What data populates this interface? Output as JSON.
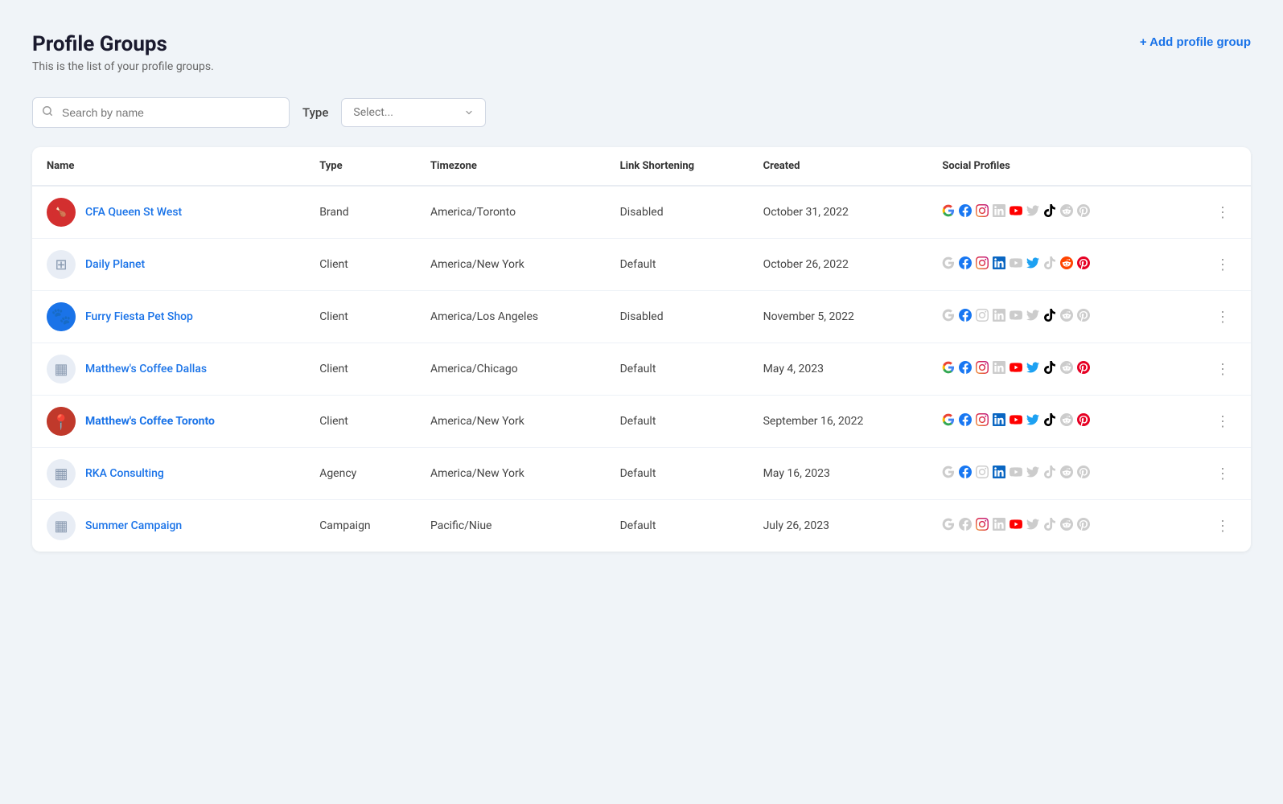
{
  "page": {
    "title": "Profile Groups",
    "subtitle": "This is the list of your profile groups.",
    "add_button_label": "+ Add profile group"
  },
  "filters": {
    "search_placeholder": "Search by name",
    "type_label": "Type",
    "type_select_placeholder": "Select..."
  },
  "table": {
    "columns": [
      "Name",
      "Type",
      "Timezone",
      "Link Shortening",
      "Created",
      "Social Profiles"
    ],
    "rows": [
      {
        "id": 1,
        "name": "CFA Queen St West",
        "avatar_type": "image",
        "avatar_emoji": "🍗",
        "avatar_bg": "#e8241a",
        "type": "Brand",
        "timezone": "America/Toronto",
        "link_shortening": "Disabled",
        "created": "October 31, 2022",
        "socials": {
          "google": true,
          "facebook": true,
          "instagram": true,
          "linkedin": false,
          "youtube": true,
          "twitter": false,
          "tiktok": true,
          "reddit": false,
          "pinterest": false
        }
      },
      {
        "id": 2,
        "name": "Daily Planet",
        "avatar_type": "building",
        "avatar_emoji": "🏢",
        "type": "Client",
        "timezone": "America/New York",
        "link_shortening": "Default",
        "created": "October 26, 2022",
        "socials": {
          "google": false,
          "facebook": true,
          "instagram": true,
          "linkedin": true,
          "youtube": false,
          "twitter": true,
          "tiktok": false,
          "reddit": true,
          "pinterest": true
        }
      },
      {
        "id": 3,
        "name": "Furry Fiesta Pet Shop",
        "avatar_type": "image",
        "avatar_emoji": "🐾",
        "avatar_bg": "#1a73e8",
        "type": "Client",
        "timezone": "America/Los Angeles",
        "link_shortening": "Disabled",
        "created": "November 5, 2022",
        "socials": {
          "google": false,
          "facebook": true,
          "instagram": false,
          "linkedin": false,
          "youtube": false,
          "twitter": false,
          "tiktok": true,
          "reddit": false,
          "pinterest": false
        }
      },
      {
        "id": 4,
        "name": "Matthew's Coffee Dallas",
        "avatar_type": "building",
        "avatar_emoji": "🏢",
        "type": "Client",
        "timezone": "America/Chicago",
        "link_shortening": "Default",
        "created": "May 4, 2023",
        "socials": {
          "google": true,
          "facebook": true,
          "instagram": true,
          "linkedin": false,
          "youtube": true,
          "twitter": true,
          "tiktok": true,
          "reddit": false,
          "pinterest": true
        }
      },
      {
        "id": 5,
        "name": "Matthew's Coffee Toronto",
        "avatar_type": "image",
        "avatar_emoji": "📍",
        "avatar_bg": "#c0392b",
        "bold": true,
        "type": "Client",
        "timezone": "America/New York",
        "link_shortening": "Default",
        "created": "September 16, 2022",
        "socials": {
          "google": true,
          "facebook": true,
          "instagram": true,
          "linkedin": true,
          "youtube": true,
          "twitter": true,
          "tiktok": true,
          "reddit": false,
          "pinterest": true
        }
      },
      {
        "id": 6,
        "name": "RKA Consulting",
        "avatar_type": "building",
        "avatar_emoji": "🏢",
        "type": "Agency",
        "timezone": "America/New York",
        "link_shortening": "Default",
        "created": "May 16, 2023",
        "socials": {
          "google": false,
          "facebook": true,
          "instagram": false,
          "linkedin": true,
          "youtube": false,
          "twitter": false,
          "tiktok": false,
          "reddit": false,
          "pinterest": false
        }
      },
      {
        "id": 7,
        "name": "Summer Campaign",
        "avatar_type": "building",
        "avatar_emoji": "🏢",
        "type": "Campaign",
        "timezone": "Pacific/Niue",
        "link_shortening": "Default",
        "created": "July 26, 2023",
        "socials": {
          "google": false,
          "facebook": false,
          "instagram": true,
          "linkedin": false,
          "youtube": true,
          "twitter": false,
          "tiktok": false,
          "reddit": false,
          "pinterest": false
        }
      }
    ]
  }
}
